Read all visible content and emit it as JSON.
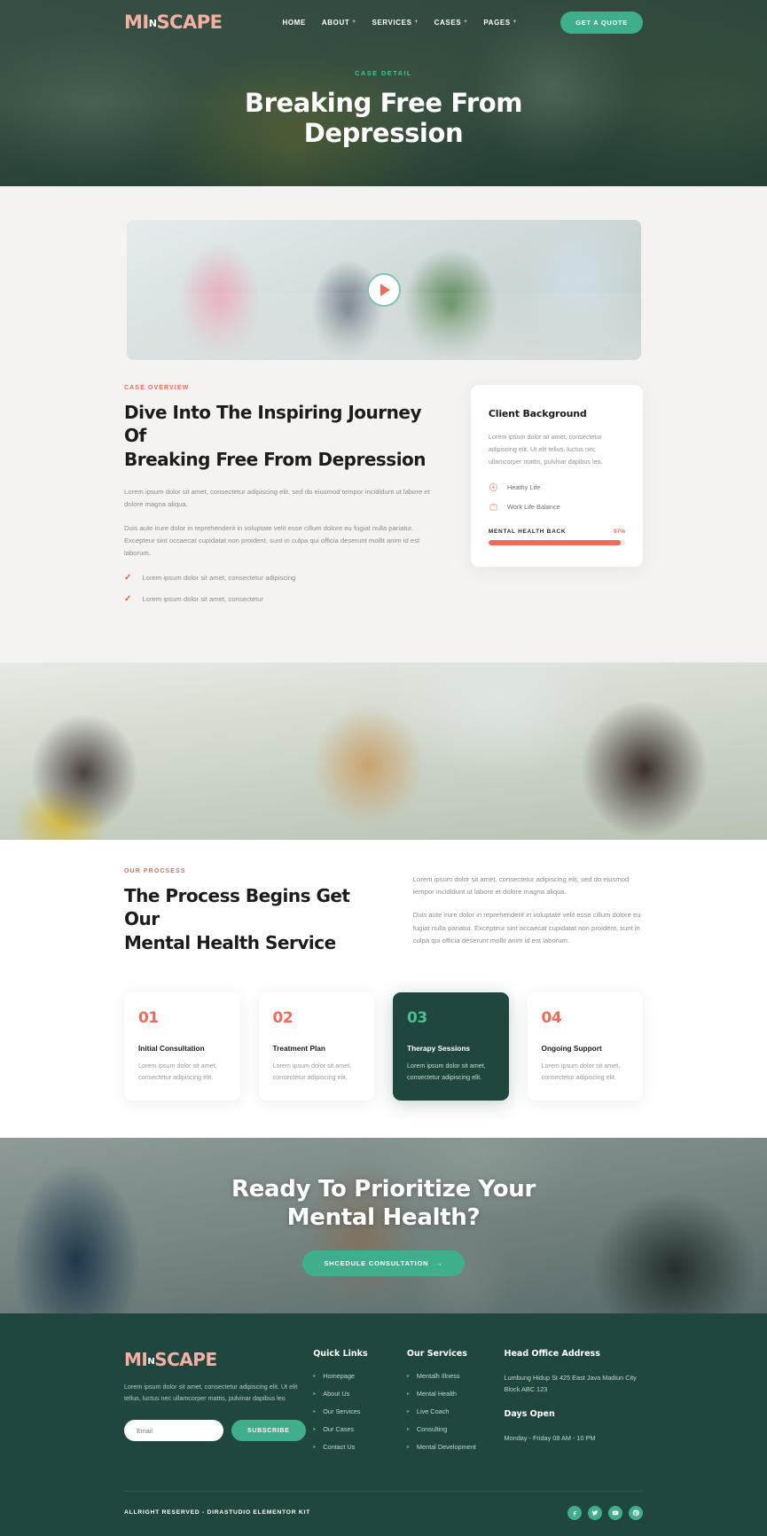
{
  "header": {
    "logo_text": "MI",
    "logo_mid": "N",
    "logo_text2": "SCAPE",
    "nav": [
      {
        "label": "HOME",
        "caret": "",
        "active": true
      },
      {
        "label": "ABOUT",
        "caret": "+",
        "active": false
      },
      {
        "label": "SERVICES",
        "caret": "+",
        "active": false
      },
      {
        "label": "CASES",
        "caret": "+",
        "active": true
      },
      {
        "label": "PAGES",
        "caret": "+",
        "active": false
      }
    ],
    "cta_label": "GET A QUOTE"
  },
  "hero": {
    "eyebrow": "CASE DETAIL",
    "title_line1": "Breaking Free From",
    "title_line2": "Depression"
  },
  "video": {
    "play_label": "play-video"
  },
  "overview": {
    "eyebrow": "CASE OVERVIEW",
    "title_line1": "Dive Into The Inspiring Journey Of",
    "title_line2": "Breaking Free From Depression",
    "paragraph1": "Lorem ipsum dolor sit amet, consectetur adipiscing elit, sed do eiusmod tempor incididunt ut labore et dolore magna aliqua.",
    "paragraph2": "Duis aute irure dolor in reprehenderit in voluptate velit esse cillum dolore eu fugiat nulla pariatur. Excepteur sint occaecat cupidatat non proident, sunt in culpa qui officia deserunt mollit anim id est laborum.",
    "checks": [
      "Lorem ipsum dolor sit amet, consectetur adipiscing",
      "Lorem ipsum dolor sit amet, consectetur"
    ]
  },
  "client_card": {
    "title": "Client Background",
    "body": "Lorem ipsum dolor sit amet, consectetur adipiscing elit. Ut elit tellus, luctus nec ullamcorper mattis, pulvinar dapibus leo.",
    "features": [
      {
        "label": "Heathy Life",
        "icon": "heart-health-icon"
      },
      {
        "label": "Work Life Balance",
        "icon": "briefcase-icon"
      }
    ],
    "bar_label": "MENTAL HEALTH BACK",
    "bar_percent": "97%",
    "bar_value": 97
  },
  "process": {
    "eyebrow": "OUR PROCSESS",
    "title_line1": "The Process Begins Get Our",
    "title_line2": "Mental Health Service",
    "paragraph1": "Lorem ipsum dolor sit amet, consectetur adipiscing elit, sed do eiusmod tempor incididunt ut labore et dolore magna aliqua.",
    "paragraph2": "Duis aute irure dolor in reprehenderit in voluptate velit esse cillum dolore eu fugiat nulla pariatur. Excepteur sint occaecat cupidatat non proident, sunt in culpa qui officia deserunt mollit anim id est laborum.",
    "cards": [
      {
        "num": "01",
        "title": "Initial Consultation",
        "text": "Lorem ipsum dolor sit amet, consectetur adipiscing elit.",
        "highlight": false
      },
      {
        "num": "02",
        "title": "Treatment Plan",
        "text": "Lorem ipsum dolor sit amet, consectetur adipiscing elit.",
        "highlight": false
      },
      {
        "num": "03",
        "title": "Therapy Sessions",
        "text": "Lorem ipsum dolor sit amet, consectetur adipiscing elit.",
        "highlight": true
      },
      {
        "num": "04",
        "title": "Ongoing Support",
        "text": "Lorem ipsum dolor sit amet, consectetur adipiscing elit.",
        "highlight": false
      }
    ]
  },
  "cta": {
    "title_line1": "Ready To Prioritize Your",
    "title_line2": "Mental Health?",
    "button_label": "SHCEDULE CONSULTATION",
    "button_arrow": "→"
  },
  "footer": {
    "logo_text": "MI",
    "logo_mid": "N",
    "logo_text2": "SCAPE",
    "description": "Lorem ipsum dolor sit amet, consectetur adipiscing elit. Ut elit tellus, luctus nec ullamcorper mattis, pulvinar dapibus leo",
    "email_placeholder": "Email",
    "subscribe_label": "SUBSCRIBE",
    "quick_links_head": "Quick Links",
    "quick_links": [
      "Homepage",
      "About Us",
      "Our Services",
      "Our Cases",
      "Contact Us"
    ],
    "services_head": "Our Services",
    "services": [
      "Mentalh Illness",
      "Mental Health",
      "Live Coach",
      "Consulting",
      "Mental Development"
    ],
    "address_head": "Head Office Address",
    "address_text": "Lumbung Hidup St 425 East Java Madiun City Block ABC 123",
    "days_head": "Days Open",
    "days_text": "Monday - Friday 08 AM - 10 PM",
    "copyright": "ALLRIGHT RESERVED - DIRASTUDIO ELEMENTOR KIT",
    "socials": [
      "facebook-icon",
      "twitter-icon",
      "youtube-icon",
      "pinterest-icon"
    ]
  },
  "colors": {
    "accent_green": "#3fae8c",
    "dark_green": "#1f4740",
    "coral": "#ef6a57",
    "logo_pink": "#f5b0a4"
  }
}
